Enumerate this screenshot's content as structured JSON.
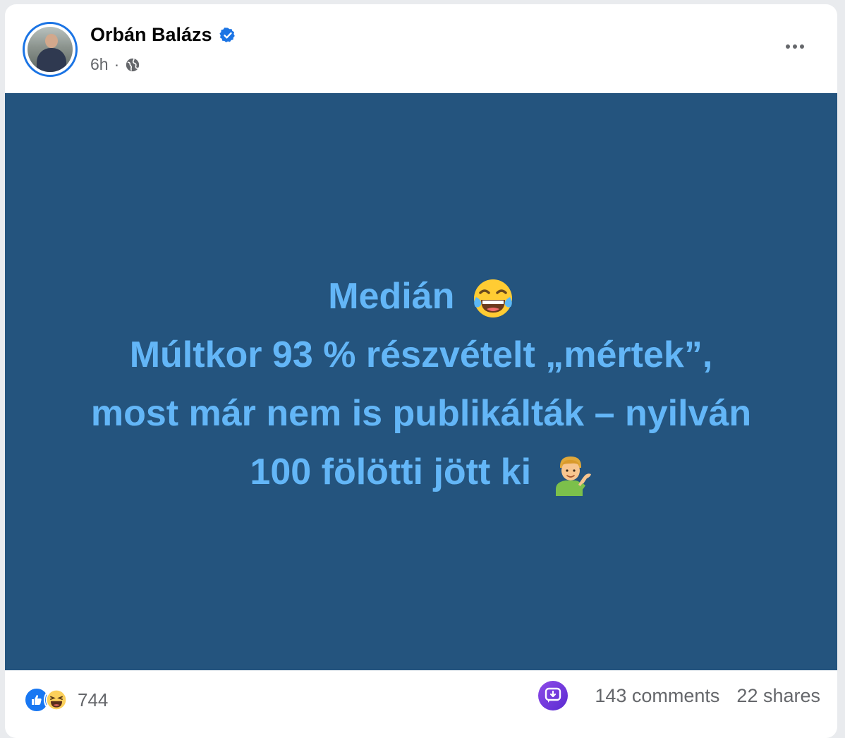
{
  "post": {
    "author": "Orbán Balázs",
    "time": "6h",
    "separator": "·",
    "audience_icon": "globe-icon",
    "verified_icon": "verified-badge-icon",
    "menu_icon": "more-options-icon",
    "image_text": {
      "line1": "Medián",
      "line1_emoji": "face-with-tears-of-joy-emoji",
      "line2": "Múltkor 93 % részvételt „mértek”,",
      "line3": "most már nem is publikálták – nyilván",
      "line4": "100 fölötti jött ki",
      "line4_emoji": "man-tipping-hand-emoji"
    },
    "background_color": "#24547e",
    "text_color": "#63b6f7"
  },
  "footer": {
    "reaction_icons": [
      "like-icon",
      "haha-icon"
    ],
    "reaction_count": "744",
    "comments": "143 comments",
    "shares": "22 shares"
  },
  "colors": {
    "accent": "#1b74e4",
    "secondary_text": "#65676b"
  }
}
